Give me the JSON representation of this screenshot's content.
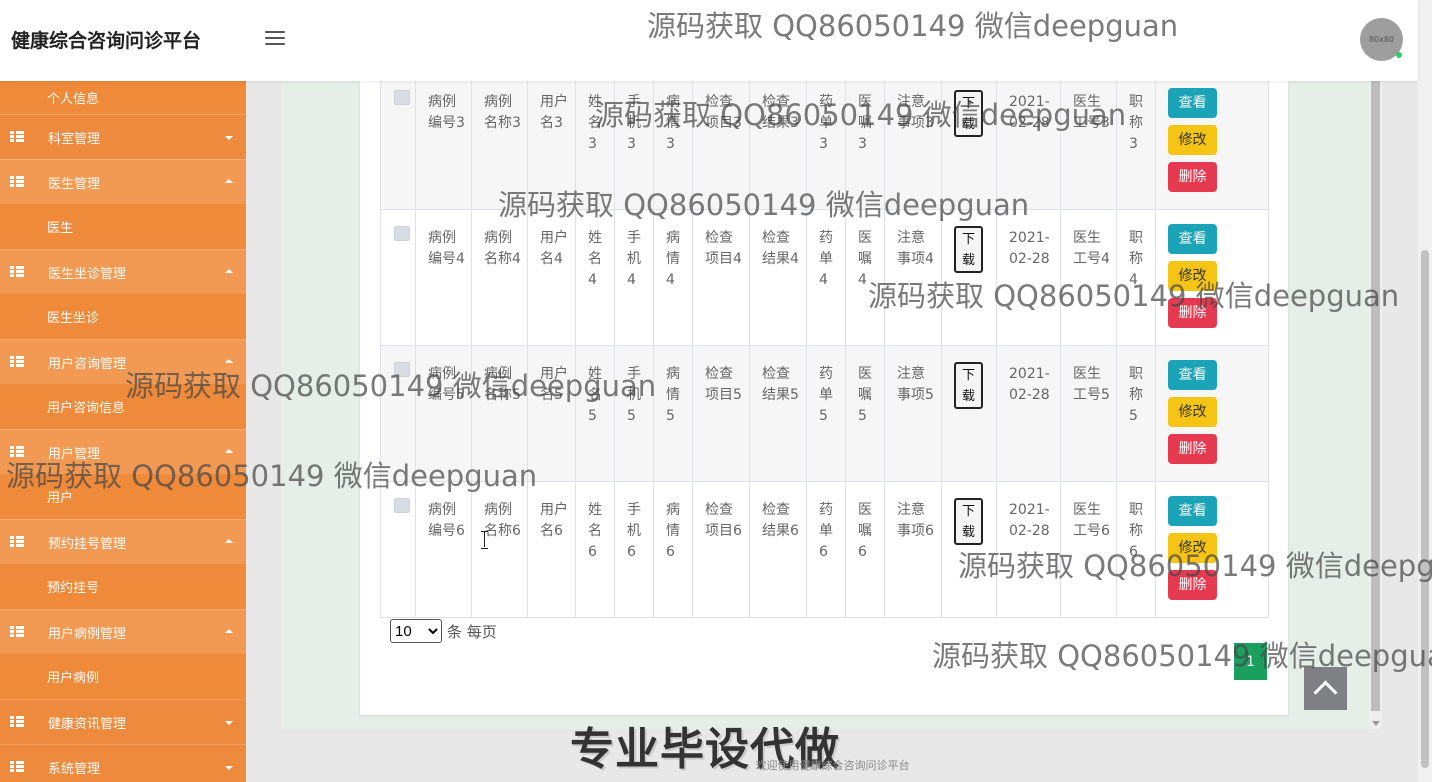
{
  "header": {
    "brand": "健康综合咨询问诊平台",
    "avatar_text": "80x80"
  },
  "sidebar": {
    "items": [
      {
        "type": "child",
        "label": "个人信息"
      },
      {
        "type": "group",
        "label": "科室管理",
        "open": false
      },
      {
        "type": "group",
        "label": "医生管理",
        "open": true
      },
      {
        "type": "child",
        "label": "医生"
      },
      {
        "type": "group",
        "label": "医生坐诊管理",
        "open": true
      },
      {
        "type": "child",
        "label": "医生坐诊"
      },
      {
        "type": "group",
        "label": "用户咨询管理",
        "open": true
      },
      {
        "type": "child",
        "label": "用户咨询信息"
      },
      {
        "type": "group",
        "label": "用户管理",
        "open": true
      },
      {
        "type": "child",
        "label": "用户"
      },
      {
        "type": "group",
        "label": "预约挂号管理",
        "open": true
      },
      {
        "type": "child",
        "label": "预约挂号"
      },
      {
        "type": "group",
        "label": "用户病例管理",
        "open": true
      },
      {
        "type": "child",
        "label": "用户病例"
      },
      {
        "type": "group",
        "label": "健康资讯管理",
        "open": false
      },
      {
        "type": "group",
        "label": "系统管理",
        "open": false
      }
    ]
  },
  "table": {
    "download_label": "下载",
    "actions": {
      "view": "查看",
      "edit": "修改",
      "delete": "删除"
    },
    "rows": [
      {
        "case_no": "病例编号3",
        "case_name": "病例名称3",
        "username": "用户名3",
        "name": "姓名3",
        "phone": "手机3",
        "condition": "病情3",
        "exam_item": "检查项目3",
        "exam_result": "检查结果3",
        "prescription": "药单3",
        "advice": "医嘱3",
        "notes": "注意事项3",
        "date": "2021-02-28",
        "doctor_id": "医生工号3",
        "title": "职称3"
      },
      {
        "case_no": "病例编号4",
        "case_name": "病例名称4",
        "username": "用户名4",
        "name": "姓名4",
        "phone": "手机4",
        "condition": "病情4",
        "exam_item": "检查项目4",
        "exam_result": "检查结果4",
        "prescription": "药单4",
        "advice": "医嘱4",
        "notes": "注意事项4",
        "date": "2021-02-28",
        "doctor_id": "医生工号4",
        "title": "职称4"
      },
      {
        "case_no": "病例编号5",
        "case_name": "病例名称5",
        "username": "用户名5",
        "name": "姓名5",
        "phone": "手机5",
        "condition": "病情5",
        "exam_item": "检查项目5",
        "exam_result": "检查结果5",
        "prescription": "药单5",
        "advice": "医嘱5",
        "notes": "注意事项5",
        "date": "2021-02-28",
        "doctor_id": "医生工号5",
        "title": "职称5"
      },
      {
        "case_no": "病例编号6",
        "case_name": "病例名称6",
        "username": "用户名6",
        "name": "姓名6",
        "phone": "手机6",
        "condition": "病情6",
        "exam_item": "检查项目6",
        "exam_result": "检查结果6",
        "prescription": "药单6",
        "advice": "医嘱6",
        "notes": "注意事项6",
        "date": "2021-02-28",
        "doctor_id": "医生工号6",
        "title": "职称6"
      }
    ]
  },
  "pagination": {
    "page_size": "10",
    "page_size_options": [
      "10"
    ],
    "suffix": "条 每页",
    "current_page": "1"
  },
  "footer": {
    "text": "欢迎使用健康综合咨询问诊平台",
    "promo": "专业毕设代做"
  },
  "watermark": "源码获取 QQ86050149 微信deepguan",
  "colors": {
    "sidebar": "#f0883a",
    "view": "#1ba3b8",
    "edit": "#f6c414",
    "delete": "#e53a4f",
    "page_active": "#1a9f5e"
  }
}
